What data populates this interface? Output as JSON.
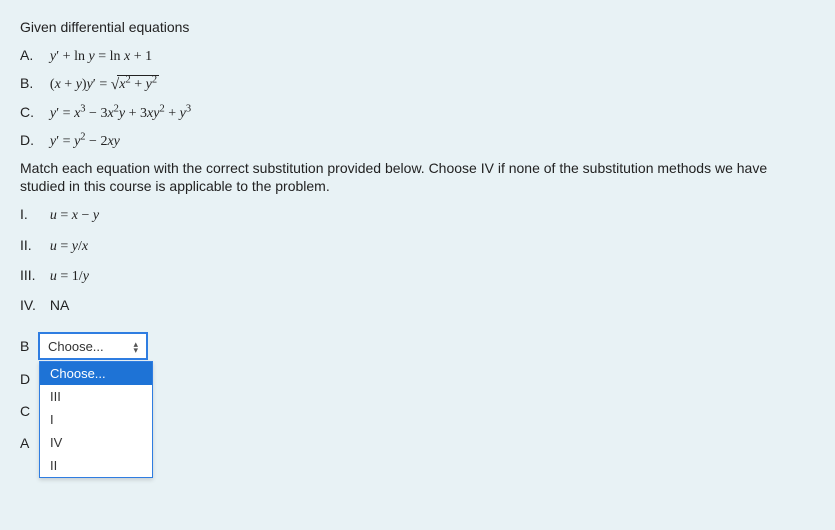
{
  "stem": {
    "intro": "Given differential equations",
    "equations": [
      {
        "label": "A.",
        "tex": "y′ + ln y = ln x + 1"
      },
      {
        "label": "B.",
        "tex": "(x + y)y′ = √(x² + y²)"
      },
      {
        "label": "C.",
        "tex": "y′ = x³ − 3x²y + 3xy² + y³"
      },
      {
        "label": "D.",
        "tex": "y′ = y² − 2xy"
      }
    ],
    "prompt": "Match each equation with the correct substitution provided below.  Choose IV if none of the substitution methods we have studied in this course is applicable to the problem.",
    "substitutions": [
      {
        "label": "I.",
        "tex": "u = x − y"
      },
      {
        "label": "II.",
        "tex": "u = y/x"
      },
      {
        "label": "III.",
        "tex": "u = 1/y"
      },
      {
        "label": "IV.",
        "tex": "NA"
      }
    ]
  },
  "match": {
    "placeholder": "Choose...",
    "rows": [
      "B",
      "D",
      "C",
      "A"
    ],
    "dropdown_open_on": "B",
    "options": [
      "Choose...",
      "III",
      "I",
      "IV",
      "II"
    ],
    "highlighted_option": "Choose..."
  }
}
